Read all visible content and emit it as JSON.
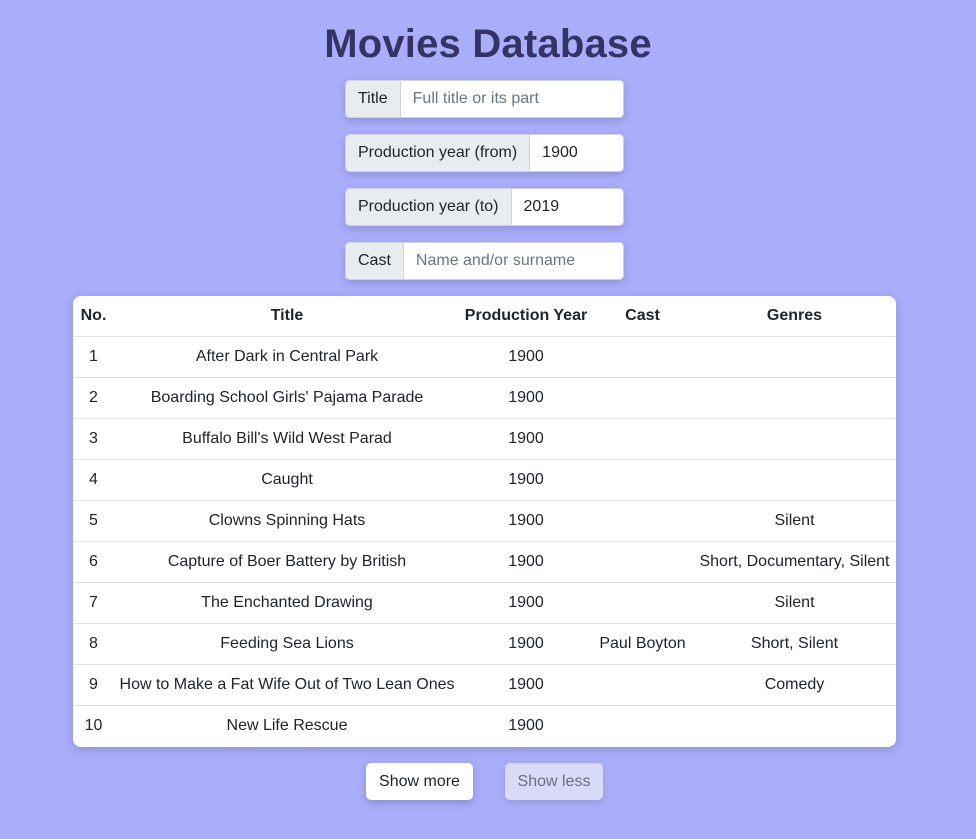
{
  "header": {
    "title": "Movies Database"
  },
  "filters": {
    "title": {
      "label": "Title",
      "value": "",
      "placeholder": "Full title or its part"
    },
    "year_from": {
      "label": "Production year (from)",
      "value": "1900",
      "placeholder": ""
    },
    "year_to": {
      "label": "Production year (to)",
      "value": "2019",
      "placeholder": ""
    },
    "cast": {
      "label": "Cast",
      "value": "",
      "placeholder": "Name and/or surname"
    }
  },
  "table": {
    "columns": [
      "No.",
      "Title",
      "Production Year",
      "Cast",
      "Genres"
    ],
    "rows": [
      {
        "no": "1",
        "title": "After Dark in Central Park",
        "year": "1900",
        "cast": "",
        "genres": ""
      },
      {
        "no": "2",
        "title": "Boarding School Girls' Pajama Parade",
        "year": "1900",
        "cast": "",
        "genres": ""
      },
      {
        "no": "3",
        "title": "Buffalo Bill's Wild West Parad",
        "year": "1900",
        "cast": "",
        "genres": ""
      },
      {
        "no": "4",
        "title": "Caught",
        "year": "1900",
        "cast": "",
        "genres": ""
      },
      {
        "no": "5",
        "title": "Clowns Spinning Hats",
        "year": "1900",
        "cast": "",
        "genres": "Silent"
      },
      {
        "no": "6",
        "title": "Capture of Boer Battery by British",
        "year": "1900",
        "cast": "",
        "genres": "Short, Documentary, Silent"
      },
      {
        "no": "7",
        "title": "The Enchanted Drawing",
        "year": "1900",
        "cast": "",
        "genres": "Silent"
      },
      {
        "no": "8",
        "title": "Feeding Sea Lions",
        "year": "1900",
        "cast": "Paul Boyton",
        "genres": "Short, Silent"
      },
      {
        "no": "9",
        "title": "How to Make a Fat Wife Out of Two Lean Ones",
        "year": "1900",
        "cast": "",
        "genres": "Comedy"
      },
      {
        "no": "10",
        "title": "New Life Rescue",
        "year": "1900",
        "cast": "",
        "genres": ""
      }
    ]
  },
  "buttons": {
    "show_more": "Show more",
    "show_less": "Show less"
  },
  "colors": {
    "background": "#aaaefa",
    "title": "#333366"
  }
}
